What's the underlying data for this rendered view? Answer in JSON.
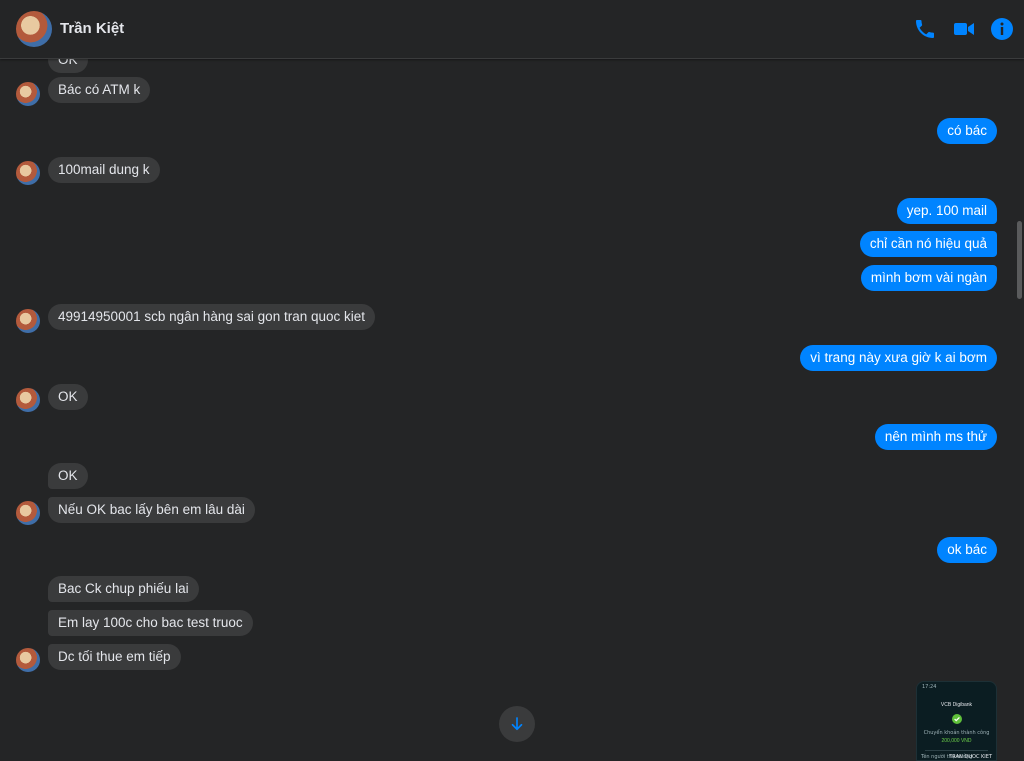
{
  "contact": {
    "name": "Trần Kiệt"
  },
  "header_icons": [
    "phone-icon",
    "video-camera-icon",
    "info-icon"
  ],
  "colors": {
    "accent": "#0084ff",
    "background": "#242526",
    "incoming_bubble": "#3a3b3c"
  },
  "messages": [
    {
      "text": "OK",
      "dir": "in"
    },
    {
      "text": "Bác có ATM k",
      "dir": "in"
    },
    {
      "text": "có bác",
      "dir": "out"
    },
    {
      "text": "100mail dung k",
      "dir": "in"
    },
    {
      "text": "yep. 100 mail",
      "dir": "out"
    },
    {
      "text": "chỉ cần nó hiệu quả",
      "dir": "out"
    },
    {
      "text": "mình bơm vài ngàn",
      "dir": "out"
    },
    {
      "text": "49914950001 scb ngân hàng sai gon tran quoc kiet",
      "dir": "in"
    },
    {
      "text": "vì trang này xưa giờ k ai bơm",
      "dir": "out"
    },
    {
      "text": "OK",
      "dir": "in"
    },
    {
      "text": "nên mình ms thử",
      "dir": "out"
    },
    {
      "text": "OK",
      "dir": "in"
    },
    {
      "text": "Nếu OK bac lấy bên em lâu dài",
      "dir": "in"
    },
    {
      "text": "ok bác",
      "dir": "out"
    },
    {
      "text": "Bac Ck chup phiếu lai",
      "dir": "in"
    },
    {
      "text": "Em lay 100c cho bac test truoc",
      "dir": "in"
    },
    {
      "text": "Dc tối thue em tiếp",
      "dir": "in"
    }
  ],
  "attachment": {
    "status_time": "17:24",
    "app_name": "VCB Digibank",
    "result_text": "Chuyển khoản thành công",
    "amount": "200,000 VND",
    "recipient_label": "Tên người thụ hưởng",
    "recipient_value": "TRAN QUOC KIET"
  }
}
